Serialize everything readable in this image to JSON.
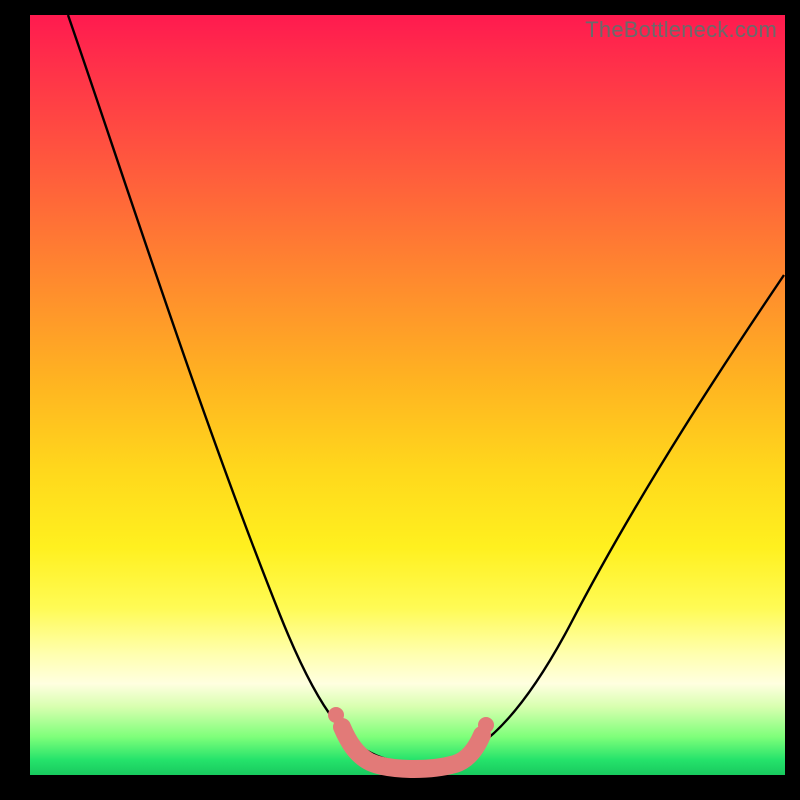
{
  "watermark": "TheBottleneck.com",
  "chart_data": {
    "type": "line",
    "title": "",
    "xlabel": "",
    "ylabel": "",
    "xlim": [
      0,
      100
    ],
    "ylim": [
      0,
      100
    ],
    "series": [
      {
        "name": "bottleneck-curve",
        "x": [
          5,
          10,
          15,
          20,
          25,
          30,
          35,
          40,
          44,
          48,
          52,
          56,
          60,
          65,
          70,
          75,
          80,
          85,
          90,
          95,
          100
        ],
        "values": [
          100,
          88,
          76,
          64,
          52,
          40,
          28,
          16,
          6,
          1,
          0,
          1,
          5,
          13,
          22,
          31,
          40,
          48,
          55,
          61,
          66
        ]
      }
    ],
    "annotations": [
      {
        "name": "valley-marker",
        "x_range": [
          41,
          58
        ],
        "y": 0
      }
    ],
    "colors": {
      "curve": "#000000",
      "marker": "#e27a78",
      "gradient_top": "#ff1a4f",
      "gradient_bottom": "#18c95e"
    }
  }
}
